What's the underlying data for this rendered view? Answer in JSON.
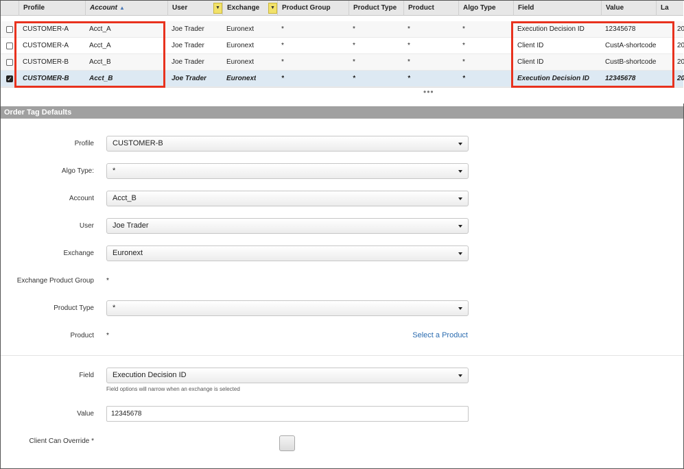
{
  "grid": {
    "columns": [
      "Profile",
      "Account",
      "User",
      "Exchange",
      "Product Group",
      "Product Type",
      "Product",
      "Algo Type",
      "Field",
      "Value",
      "La"
    ],
    "rows": [
      {
        "checked": false,
        "profile": "CUSTOMER-A",
        "account": "Acct_A",
        "user": "Joe Trader",
        "exchange": "Euronext",
        "product_group": "*",
        "product_type": "*",
        "product": "*",
        "algo_type": "*",
        "field": "Execution Decision ID",
        "value": "12345678",
        "last": "20"
      },
      {
        "checked": false,
        "profile": "CUSTOMER-A",
        "account": "Acct_A",
        "user": "Joe Trader",
        "exchange": "Euronext",
        "product_group": "*",
        "product_type": "*",
        "product": "*",
        "algo_type": "*",
        "field": "Client ID",
        "value": "CustA-shortcode",
        "last": "20"
      },
      {
        "checked": false,
        "profile": "CUSTOMER-B",
        "account": "Acct_B",
        "user": "Joe Trader",
        "exchange": "Euronext",
        "product_group": "*",
        "product_type": "*",
        "product": "*",
        "algo_type": "*",
        "field": "Client ID",
        "value": "CustB-shortcode",
        "last": "20"
      },
      {
        "checked": true,
        "profile": "CUSTOMER-B",
        "account": "Acct_B",
        "user": "Joe Trader",
        "exchange": "Euronext",
        "product_group": "*",
        "product_type": "*",
        "product": "*",
        "algo_type": "*",
        "field": "Execution Decision ID",
        "value": "12345678",
        "last": "20"
      }
    ],
    "more": "•••",
    "highlight_color": "#e8321e",
    "selected_row_color": "#dde9f3"
  },
  "section": {
    "title": "Order Tag Defaults"
  },
  "form": {
    "profile_label": "Profile",
    "profile_value": "CUSTOMER-B",
    "algo_type_label": "Algo Type:",
    "algo_type_value": "*",
    "account_label": "Account",
    "account_value": "Acct_B",
    "user_label": "User",
    "user_value": "Joe Trader",
    "exchange_label": "Exchange",
    "exchange_value": "Euronext",
    "product_group_label": "Exchange Product Group",
    "product_group_value": "*",
    "product_type_label": "Product Type",
    "product_type_value": "*",
    "product_label": "Product",
    "product_value": "*",
    "select_product_link": "Select a Product",
    "field_label": "Field",
    "field_value": "Execution Decision ID",
    "field_hint": "Field options will narrow when an exchange is selected",
    "value_label": "Value",
    "value_value": "12345678",
    "override_label": "Client Can Override *"
  }
}
